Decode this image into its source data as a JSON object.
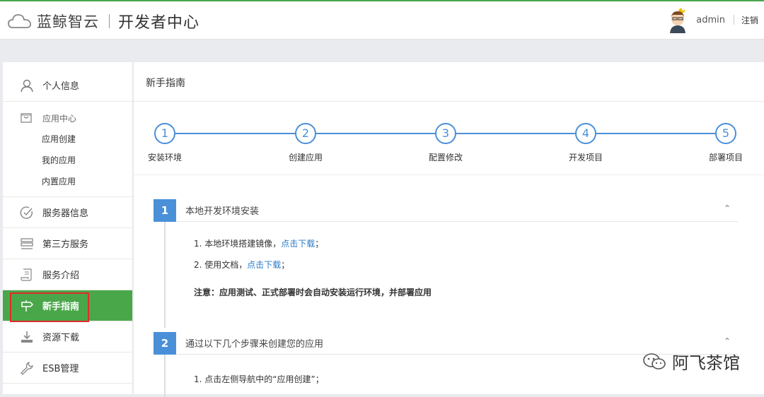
{
  "header": {
    "brand_name": "蓝鲸智云",
    "section_title": "开发者中心",
    "username": "admin",
    "logout": "注销"
  },
  "sidebar": {
    "profile": "个人信息",
    "app_center": "应用中心",
    "app_sub": [
      "应用创建",
      "我的应用",
      "内置应用"
    ],
    "server_info": "服务器信息",
    "third_party": "第三方服务",
    "service_intro": "服务介绍",
    "guide": "新手指南",
    "downloads": "资源下载",
    "esb": "ESB管理"
  },
  "main": {
    "title": "新手指南",
    "steps": [
      {
        "num": "1",
        "label": "安装环境"
      },
      {
        "num": "2",
        "label": "创建应用"
      },
      {
        "num": "3",
        "label": "配置修改"
      },
      {
        "num": "4",
        "label": "开发项目"
      },
      {
        "num": "5",
        "label": "部署项目"
      }
    ],
    "section1": {
      "num": "1",
      "title": "本地开发环境安装",
      "item1_text": "1.  本地环境搭建镜像，",
      "item1_link": "点击下载",
      "item1_tail": "；",
      "item2_text": "2.  使用文档，",
      "item2_link": "点击下载",
      "item2_tail": "；",
      "note": "注意：应用测试、正式部署时会自动安装运行环境，并部署应用"
    },
    "section2": {
      "num": "2",
      "title": "通过以下几个步骤来创建您的应用",
      "item1": "1.  点击左侧导航中的“应用创建”；"
    }
  },
  "watermark": {
    "text": "阿飞茶馆"
  },
  "colors": {
    "accent_green": "#49a74a",
    "accent_blue": "#4a90d9",
    "link_blue": "#2a7ac9",
    "highlight_red": "#e02b2b"
  }
}
